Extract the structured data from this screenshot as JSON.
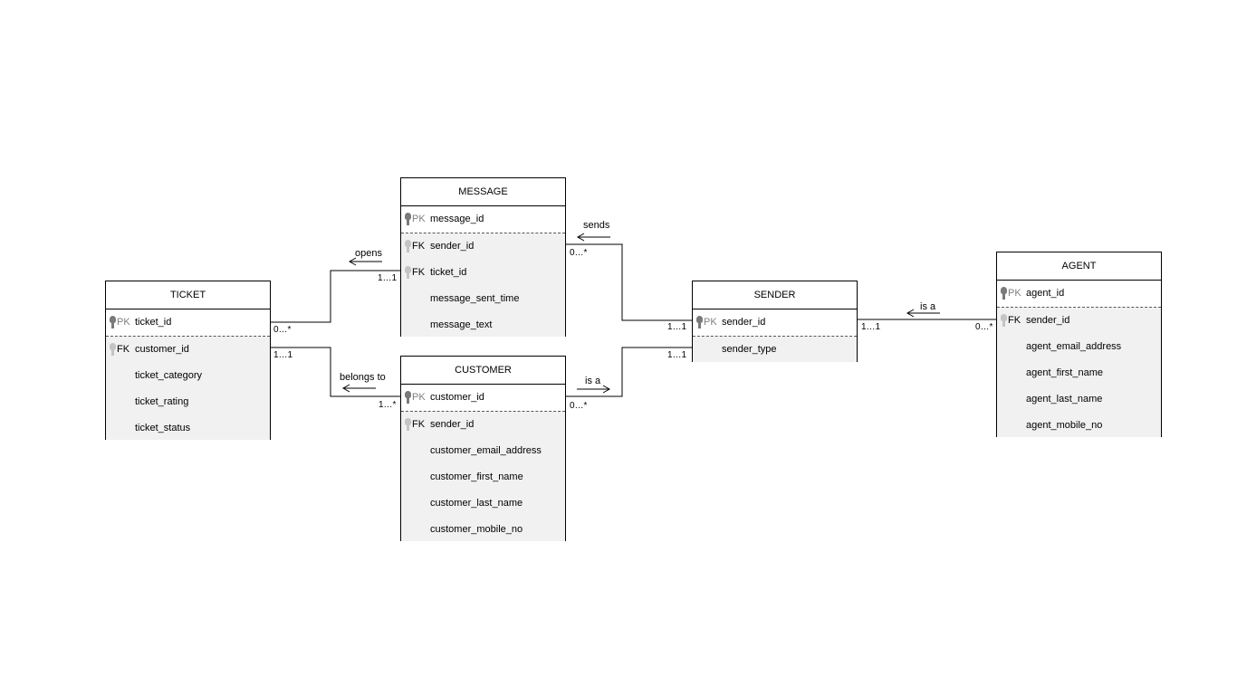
{
  "diagram": {
    "type": "entity-relationship",
    "entities": [
      {
        "id": "ticket",
        "name": "TICKET",
        "pk": {
          "key": "PK",
          "name": "ticket_id"
        },
        "attributes": [
          {
            "key": "FK",
            "name": "customer_id"
          },
          {
            "key": "",
            "name": "ticket_category"
          },
          {
            "key": "",
            "name": "ticket_rating"
          },
          {
            "key": "",
            "name": "ticket_status"
          }
        ]
      },
      {
        "id": "message",
        "name": "MESSAGE",
        "pk": {
          "key": "PK",
          "name": "message_id"
        },
        "attributes": [
          {
            "key": "FK",
            "name": "sender_id"
          },
          {
            "key": "FK",
            "name": "ticket_id"
          },
          {
            "key": "",
            "name": "message_sent_time"
          },
          {
            "key": "",
            "name": "message_text"
          }
        ]
      },
      {
        "id": "customer",
        "name": "CUSTOMER",
        "pk": {
          "key": "PK",
          "name": "customer_id"
        },
        "attributes": [
          {
            "key": "FK",
            "name": "sender_id"
          },
          {
            "key": "",
            "name": "customer_email_address"
          },
          {
            "key": "",
            "name": "customer_first_name"
          },
          {
            "key": "",
            "name": "customer_last_name"
          },
          {
            "key": "",
            "name": "customer_mobile_no"
          }
        ]
      },
      {
        "id": "sender",
        "name": "SENDER",
        "pk": {
          "key": "PK",
          "name": "sender_id"
        },
        "attributes": [
          {
            "key": "",
            "name": "sender_type"
          }
        ]
      },
      {
        "id": "agent",
        "name": "AGENT",
        "pk": {
          "key": "PK",
          "name": "agent_id"
        },
        "attributes": [
          {
            "key": "FK",
            "name": "sender_id"
          },
          {
            "key": "",
            "name": "agent_email_address"
          },
          {
            "key": "",
            "name": "agent_first_name"
          },
          {
            "key": "",
            "name": "agent_last_name"
          },
          {
            "key": "",
            "name": "agent_mobile_no"
          }
        ]
      }
    ],
    "relationships": [
      {
        "id": "opens",
        "label": "opens",
        "from": "ticket",
        "to": "message",
        "from_card": "0…*",
        "to_card": "1…1",
        "arrow": "left"
      },
      {
        "id": "belongs_to",
        "label": "belongs to",
        "from": "ticket",
        "to": "customer",
        "from_card": "1…1",
        "to_card": "1…*",
        "arrow": "left"
      },
      {
        "id": "sends",
        "label": "sends",
        "from": "message",
        "to": "sender",
        "from_card": "0…*",
        "to_card": "1…1",
        "arrow": "left"
      },
      {
        "id": "customer_is_a",
        "label": "is a",
        "from": "customer",
        "to": "sender",
        "from_card": "0…*",
        "to_card": "1…1",
        "arrow": "right"
      },
      {
        "id": "agent_is_a",
        "label": "is a",
        "from": "sender",
        "to": "agent",
        "from_card": "1…1",
        "to_card": "0…*",
        "arrow": "left"
      }
    ]
  }
}
